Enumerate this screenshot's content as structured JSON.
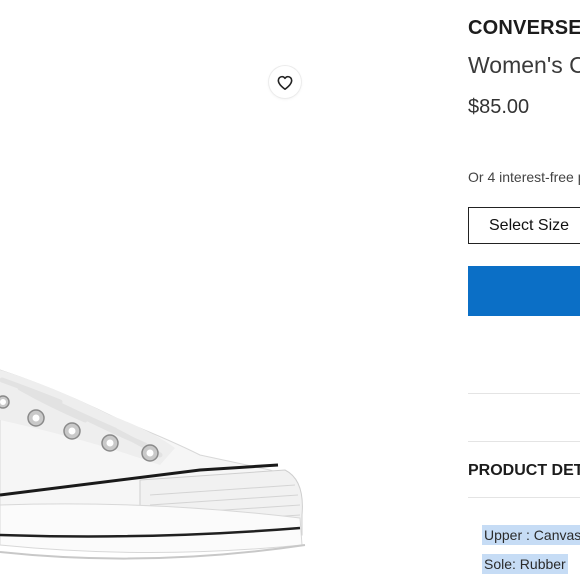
{
  "product": {
    "brand": "CONVERSE",
    "name": "Women's C",
    "price": "$85.00",
    "installments": "Or 4 interest-free p",
    "select_size_label": "Select Size",
    "add_button_color": "#0b6fc6"
  },
  "details": {
    "title": "PRODUCT DET",
    "items": [
      "Upper : Canvas",
      "Sole: Rubber"
    ]
  },
  "icons": {
    "wishlist": "heart-icon"
  }
}
